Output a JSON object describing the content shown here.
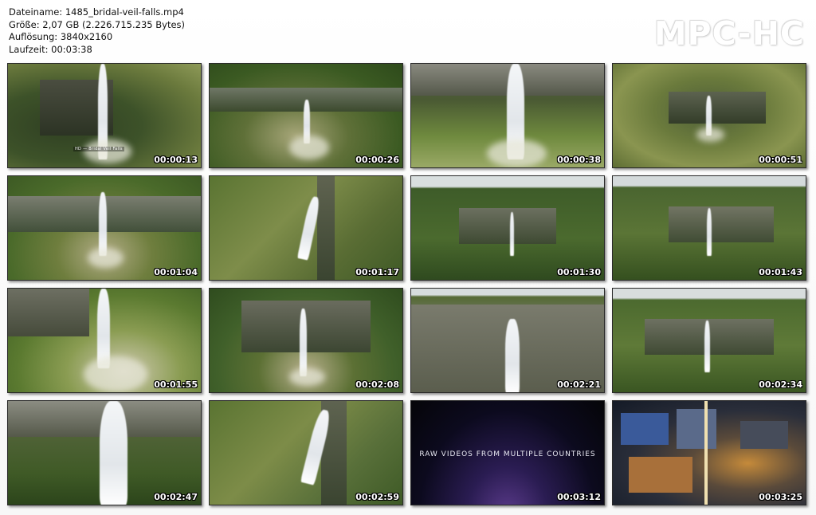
{
  "file_info": {
    "filename": "Dateiname: 1485_bridal-veil-falls.mp4",
    "size": "Größe: 2,07 GB (2.226.715.235 Bytes)",
    "resolution": "Auflösung: 3840x2160",
    "duration": "Laufzeit: 00:03:38"
  },
  "logo": "MPC-HC",
  "thumbnails": [
    {
      "time": "00:00:13",
      "scene": "waterfall-gorge-closeup",
      "caption": "HD — Bridal Veil Falls"
    },
    {
      "time": "00:00:26",
      "scene": "waterfall-aerial-pool"
    },
    {
      "time": "00:00:38",
      "scene": "waterfall-cliff-closeup"
    },
    {
      "time": "00:00:51",
      "scene": "waterfall-forest-aerial"
    },
    {
      "time": "00:01:04",
      "scene": "waterfall-basin"
    },
    {
      "time": "00:01:17",
      "scene": "waterfall-side-angle"
    },
    {
      "time": "00:01:30",
      "scene": "waterfall-wide-gorge"
    },
    {
      "time": "00:01:43",
      "scene": "waterfall-wide-gorge-2"
    },
    {
      "time": "00:01:55",
      "scene": "waterfall-pool-closeup"
    },
    {
      "time": "00:02:08",
      "scene": "waterfall-amphitheatre"
    },
    {
      "time": "00:02:21",
      "scene": "waterfall-cliff-face"
    },
    {
      "time": "00:02:34",
      "scene": "waterfall-wide-view"
    },
    {
      "time": "00:02:47",
      "scene": "waterfall-closeup-top"
    },
    {
      "time": "00:02:59",
      "scene": "waterfall-side-angle-2"
    },
    {
      "time": "00:03:12",
      "scene": "end-title-card",
      "caption": "RAW VIDEOS FROM MULTIPLE COUNTRIES"
    },
    {
      "time": "00:03:25",
      "scene": "city-night-aerial"
    }
  ]
}
